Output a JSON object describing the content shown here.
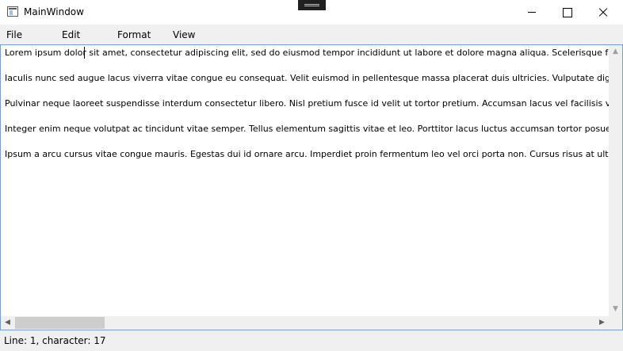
{
  "window": {
    "title": "MainWindow"
  },
  "menu": {
    "items": [
      "File",
      "Edit",
      "Format",
      "View"
    ]
  },
  "editor": {
    "lines": [
      "Lorem ipsum dolor sit amet, consectetur adipiscing elit, sed do eiusmod tempor incididunt ut labore et dolore magna aliqua. Scelerisque felis im",
      "Iaculis nunc sed augue lacus viverra vitae congue eu consequat. Velit euismod in pellentesque massa placerat duis ultricies. Vulputate dignissim s",
      "Pulvinar neque laoreet suspendisse interdum consectetur libero. Nisl pretium fusce id velit ut tortor pretium. Accumsan lacus vel facilisis volutpat",
      "Integer enim neque volutpat ac tincidunt vitae semper. Tellus elementum sagittis vitae et leo. Porttitor lacus luctus accumsan tortor posuere ac. C",
      "Ipsum a arcu cursus vitae congue mauris. Egestas dui id ornare arcu. Imperdiet proin fermentum leo vel orci porta non. Cursus risus at ultrices mi"
    ]
  },
  "status": {
    "text": "Line: 1, character: 17"
  },
  "icons": {
    "app": "window-app-icon",
    "minimize": "minimize-icon",
    "maximize": "maximize-icon",
    "close": "close-icon"
  },
  "colors": {
    "accent_border": "#7a9cd3",
    "chrome": "#f0f0f0",
    "scroll_thumb": "#cdcdcd"
  }
}
